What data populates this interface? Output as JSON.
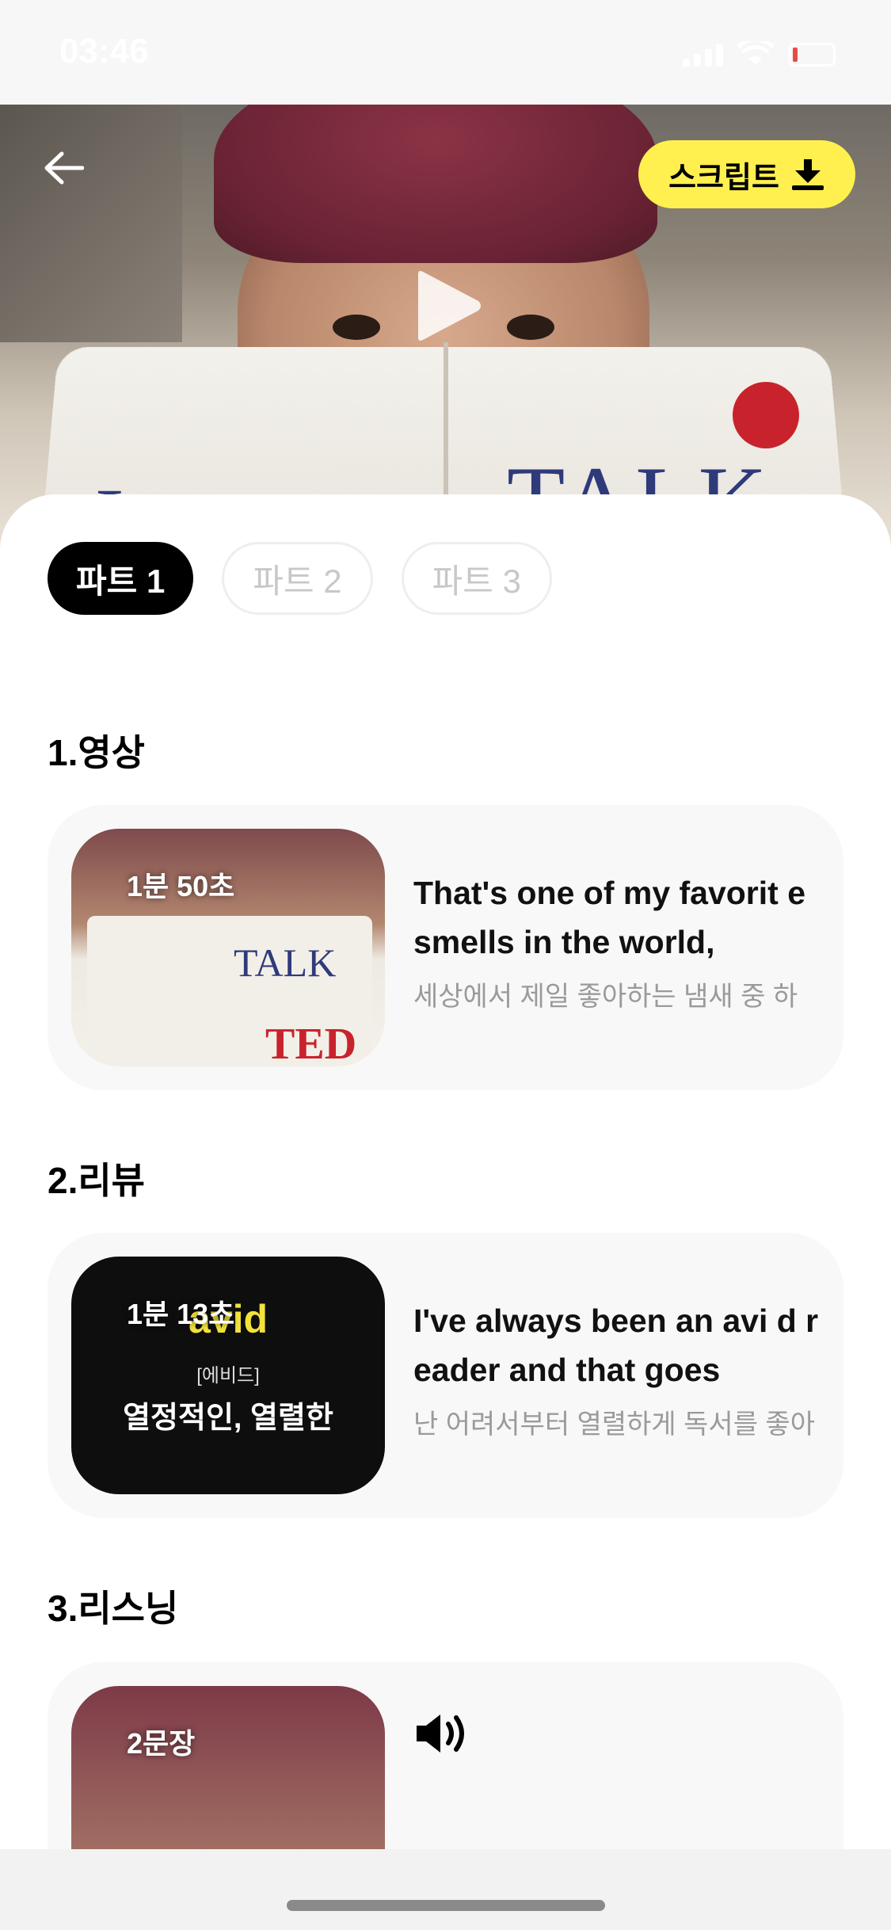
{
  "status_bar": {
    "time": "03:46"
  },
  "header": {
    "script_button_label": "스크립트"
  },
  "tabs": [
    {
      "label": "파트 1",
      "active": true
    },
    {
      "label": "파트 2",
      "active": false
    },
    {
      "label": "파트 3",
      "active": false
    }
  ],
  "sections": [
    {
      "title": "1.영상",
      "duration": "1분 50초",
      "english": "That's one of my favorit e smells in the world,",
      "korean": "세상에서 제일 좋아하는 냄새 중 하"
    },
    {
      "title": "2.리뷰",
      "duration": "1분 13초",
      "thumb_word": "avid",
      "thumb_pron": "[에비드]",
      "thumb_meaning": "열정적인, 열렬한",
      "english": "I've always been an avi d reader and that goes",
      "korean": "난 어려서부터 열렬하게 독서를 좋아"
    },
    {
      "title": "3.리스닝",
      "duration": "2문장"
    }
  ],
  "hero_book": {
    "title_right": "TALK",
    "title_left": "I"
  },
  "colors": {
    "accent_yellow": "#fff04f",
    "active_tab": "#000000",
    "card_bg": "#f8f8f8"
  },
  "icons": [
    "back-arrow-icon",
    "play-icon",
    "download-icon",
    "speaker-icon"
  ]
}
